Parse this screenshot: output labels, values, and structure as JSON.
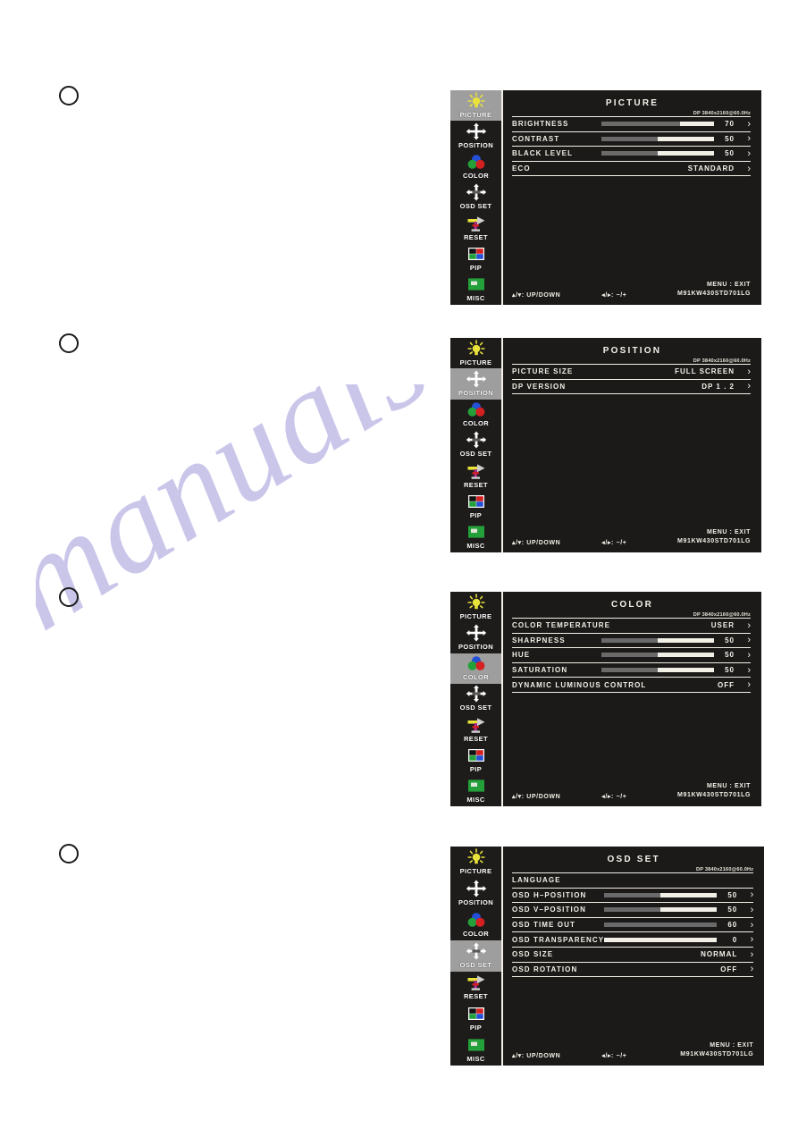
{
  "page": {
    "watermark": "manualshive.com"
  },
  "sidebar_items": [
    {
      "label": "PICTURE",
      "icon": "lightbulb-icon"
    },
    {
      "label": "POSITION",
      "icon": "four-arrows-icon"
    },
    {
      "label": "COLOR",
      "icon": "rgb-circles-icon"
    },
    {
      "label": "OSD SET",
      "icon": "four-arrows-osd-icon"
    },
    {
      "label": "RESET",
      "icon": "reset-tool-icon"
    },
    {
      "label": "PIP",
      "icon": "pip-quad-icon"
    },
    {
      "label": "MISC",
      "icon": "misc-green-icon"
    }
  ],
  "footer": {
    "updown": "▴/▾: UP/DOWN",
    "plusminus": "◂/▸: −/+",
    "menu_exit": "MENU : EXIT",
    "model": "M91KW430STD701LG"
  },
  "resolution": "DP  3840x2160@60.0Hz",
  "panels": [
    {
      "marker": "step-marker-1",
      "title": "PICTURE",
      "active_index": 0,
      "rows": [
        {
          "label": "BRIGHTNESS",
          "type": "slider",
          "value": "70",
          "percent": 70
        },
        {
          "label": "CONTRAST",
          "type": "slider",
          "value": "50",
          "percent": 50
        },
        {
          "label": "BLACK LEVEL",
          "type": "slider",
          "value": "50",
          "percent": 50
        },
        {
          "label": "ECO",
          "type": "text",
          "value": "STANDARD"
        }
      ]
    },
    {
      "marker": "step-marker-2",
      "title": "POSITION",
      "active_index": 1,
      "rows": [
        {
          "label": "PICTURE  SIZE",
          "type": "text",
          "value": "FULL  SCREEN"
        },
        {
          "label": "DP  VERSION",
          "type": "text",
          "value": "DP  1 . 2"
        }
      ]
    },
    {
      "marker": "step-marker-3",
      "title": "COLOR",
      "active_index": 2,
      "rows": [
        {
          "label": "COLOR  TEMPERATURE",
          "type": "text",
          "value": "USER"
        },
        {
          "label": "SHARPNESS",
          "type": "slider",
          "value": "50",
          "percent": 50
        },
        {
          "label": "HUE",
          "type": "slider",
          "value": "50",
          "percent": 50
        },
        {
          "label": "SATURATION",
          "type": "slider",
          "value": "50",
          "percent": 50
        },
        {
          "label": "DYNAMIC  LUMINOUS  CONTROL",
          "type": "text",
          "value": "OFF"
        }
      ]
    },
    {
      "marker": "step-marker-4",
      "title": "OSD  SET",
      "active_index": 3,
      "rows": [
        {
          "label": "LANGUAGE",
          "type": "blank",
          "value": ""
        },
        {
          "label": "OSD  H–POSITION",
          "type": "slider",
          "value": "50",
          "percent": 50
        },
        {
          "label": "OSD  V–POSITION",
          "type": "slider",
          "value": "50",
          "percent": 50
        },
        {
          "label": "OSD  TIME  OUT",
          "type": "slider",
          "value": "60",
          "percent": 100
        },
        {
          "label": "OSD   TRANSPARENCY",
          "type": "slider",
          "value": "0",
          "percent": 0
        },
        {
          "label": "OSD  SIZE",
          "type": "text",
          "value": "NORMAL"
        },
        {
          "label": "OSD  ROTATION",
          "type": "text",
          "value": "OFF"
        }
      ]
    }
  ],
  "colors": {
    "osd_bg": "#1c1a19",
    "osd_text": "#f2efe6",
    "active_tab": "#9e9e9e",
    "slider_fill": "#6a6a6a",
    "watermark": "#b9b4e4"
  }
}
